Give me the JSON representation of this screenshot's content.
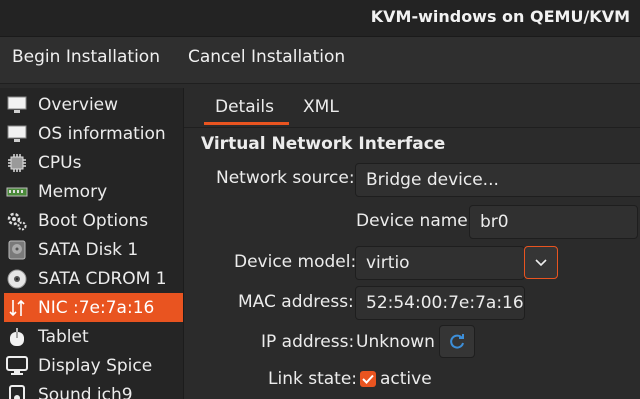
{
  "window": {
    "title": "KVM-windows on QEMU/KVM"
  },
  "toolbar": {
    "begin_label": "Begin Installation",
    "cancel_label": "Cancel Installation"
  },
  "sidebar": {
    "items": [
      {
        "label": "Overview",
        "icon": "monitor-icon"
      },
      {
        "label": "OS information",
        "icon": "monitor-icon"
      },
      {
        "label": "CPUs",
        "icon": "cpu-icon"
      },
      {
        "label": "Memory",
        "icon": "memory-icon"
      },
      {
        "label": "Boot Options",
        "icon": "gears-icon"
      },
      {
        "label": "SATA Disk 1",
        "icon": "disk-icon"
      },
      {
        "label": "SATA CDROM 1",
        "icon": "cdrom-icon"
      },
      {
        "label": "NIC :7e:7a:16",
        "icon": "network-icon",
        "selected": true
      },
      {
        "label": "Tablet",
        "icon": "tablet-icon"
      },
      {
        "label": "Display Spice",
        "icon": "display-icon"
      },
      {
        "label": "Sound ich9",
        "icon": "speaker-icon"
      }
    ]
  },
  "tabs": [
    {
      "label": "Details",
      "active": true
    },
    {
      "label": "XML"
    }
  ],
  "nic": {
    "section_title": "Virtual Network Interface",
    "network_source_label": "Network source:",
    "network_source_value": "Bridge device...",
    "device_name_label": "Device name:",
    "device_name_value": "br0",
    "device_model_label": "Device model:",
    "device_model_value": "virtio",
    "mac_label": "MAC address:",
    "mac_value": "52:54:00:7e:7a:16",
    "ip_label": "IP address:",
    "ip_value": "Unknown",
    "link_label": "Link state:",
    "link_value": "active",
    "link_checked": true
  },
  "colors": {
    "accent": "#e95420",
    "refresh_icon": "#3d8fd9"
  }
}
